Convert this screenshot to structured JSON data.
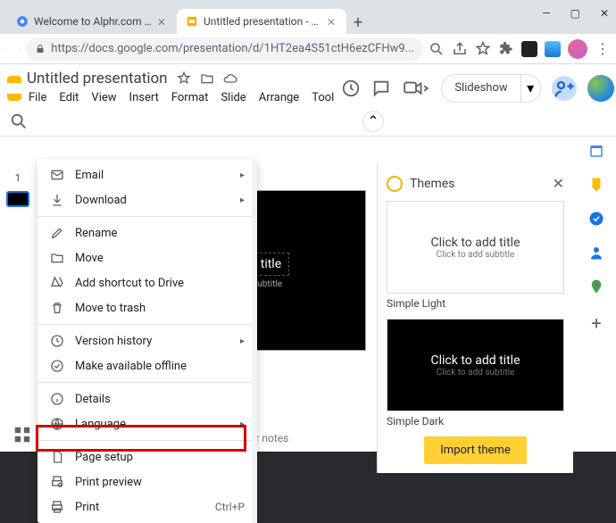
{
  "browser": {
    "tabs": [
      {
        "title": "Welcome to Alphr.com - Google"
      },
      {
        "title": "Untitled presentation - Google S"
      }
    ],
    "url": "https://docs.google.com/presentation/d/1HT2ea4S51ctH6ezCFHw9..."
  },
  "doc": {
    "title": "Untitled presentation",
    "menus": [
      "File",
      "Edit",
      "View",
      "Insert",
      "Format",
      "Slide",
      "Arrange",
      "Tool"
    ],
    "slideshow": "Slideshow"
  },
  "slide": {
    "num": "1",
    "title": "add title",
    "subtitle": "add subtitle",
    "notes": "er notes"
  },
  "themes": {
    "title": "Themes",
    "card_title": "Click to add title",
    "card_sub": "Click to add subtitle",
    "label1": "Simple Light",
    "label2": "Simple Dark",
    "import": "Import theme"
  },
  "file_menu": {
    "email": "Email",
    "download": "Download",
    "rename": "Rename",
    "move": "Move",
    "shortcut": "Add shortcut to Drive",
    "trash": "Move to trash",
    "version": "Version history",
    "offline": "Make available offline",
    "details": "Details",
    "language": "Language",
    "page_setup": "Page setup",
    "print_preview": "Print preview",
    "print": "Print",
    "print_sc": "Ctrl+P"
  }
}
